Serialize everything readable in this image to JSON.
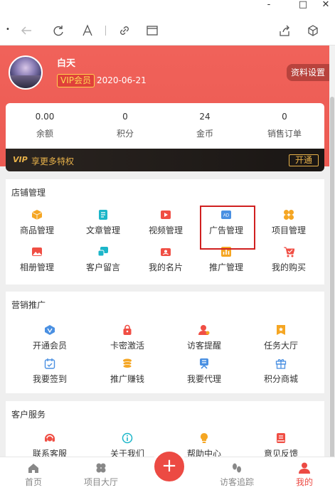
{
  "window": {
    "minimize": "-",
    "maximize": "□",
    "close": "✕"
  },
  "toolbar": {
    "icons": [
      "back-icon",
      "refresh-icon",
      "font-icon",
      "link-icon",
      "window-icon",
      "share-icon",
      "cube-icon"
    ]
  },
  "user": {
    "name": "白天",
    "vip_label": "VIP会员",
    "vip_date": "2020-06-21",
    "settings_label": "资料设置"
  },
  "stats": [
    {
      "value": "0.00",
      "label": "余额"
    },
    {
      "value": "0",
      "label": "积分"
    },
    {
      "value": "24",
      "label": "金币"
    },
    {
      "value": "0",
      "label": "销售订单"
    }
  ],
  "vip_bar": {
    "logo": "VIP",
    "text": "享更多特权",
    "button": "开通"
  },
  "shop": {
    "title": "店铺管理",
    "items": [
      {
        "label": "商品管理",
        "icon": "box-icon",
        "color": "#f5a623"
      },
      {
        "label": "文章管理",
        "icon": "article-icon",
        "color": "#1cb6c9"
      },
      {
        "label": "视频管理",
        "icon": "video-icon",
        "color": "#f04e44"
      },
      {
        "label": "广告管理",
        "icon": "ad-icon",
        "color": "#4a90e2"
      },
      {
        "label": "项目管理",
        "icon": "grid-icon",
        "color": "#f5a623"
      },
      {
        "label": "相册管理",
        "icon": "photo-icon",
        "color": "#f04e44"
      },
      {
        "label": "客户留言",
        "icon": "message-icon",
        "color": "#1cb6c9"
      },
      {
        "label": "我的名片",
        "icon": "card-icon",
        "color": "#f04e44"
      },
      {
        "label": "推广管理",
        "icon": "chart-icon",
        "color": "#f5a623"
      },
      {
        "label": "我的购买",
        "icon": "cart-icon",
        "color": "#f04e44"
      }
    ]
  },
  "marketing": {
    "title": "营销推广",
    "items": [
      {
        "label": "开通会员",
        "icon": "vip-icon",
        "color": "#4a90e2"
      },
      {
        "label": "卡密激活",
        "icon": "lock-icon",
        "color": "#f04e44"
      },
      {
        "label": "访客提醒",
        "icon": "visitor-icon",
        "color": "#f04e44"
      },
      {
        "label": "任务大厅",
        "icon": "task-icon",
        "color": "#f5a623"
      },
      {
        "label": "我要签到",
        "icon": "checkin-icon",
        "color": "#4a90e2"
      },
      {
        "label": "推广赚钱",
        "icon": "coins-icon",
        "color": "#f5a623"
      },
      {
        "label": "我要代理",
        "icon": "agent-icon",
        "color": "#4a90e2"
      },
      {
        "label": "积分商城",
        "icon": "gift-icon",
        "color": "#4a90e2"
      }
    ]
  },
  "service": {
    "title": "客户服务",
    "items": [
      {
        "label": "联系客服",
        "icon": "support-icon",
        "color": "#f04e44"
      },
      {
        "label": "关于我们",
        "icon": "info-icon",
        "color": "#1cb6c9"
      },
      {
        "label": "帮助中心",
        "icon": "bulb-icon",
        "color": "#f5a623"
      },
      {
        "label": "意见反馈",
        "icon": "feedback-icon",
        "color": "#f04e44"
      }
    ]
  },
  "nav": {
    "items": [
      {
        "label": "首页",
        "icon": "home-icon"
      },
      {
        "label": "项目大厅",
        "icon": "clover-icon"
      },
      {
        "label": "访客追踪",
        "icon": "footprint-icon"
      },
      {
        "label": "我的",
        "icon": "user-icon"
      }
    ],
    "plus": "+",
    "active_color": "#ec4a43"
  }
}
